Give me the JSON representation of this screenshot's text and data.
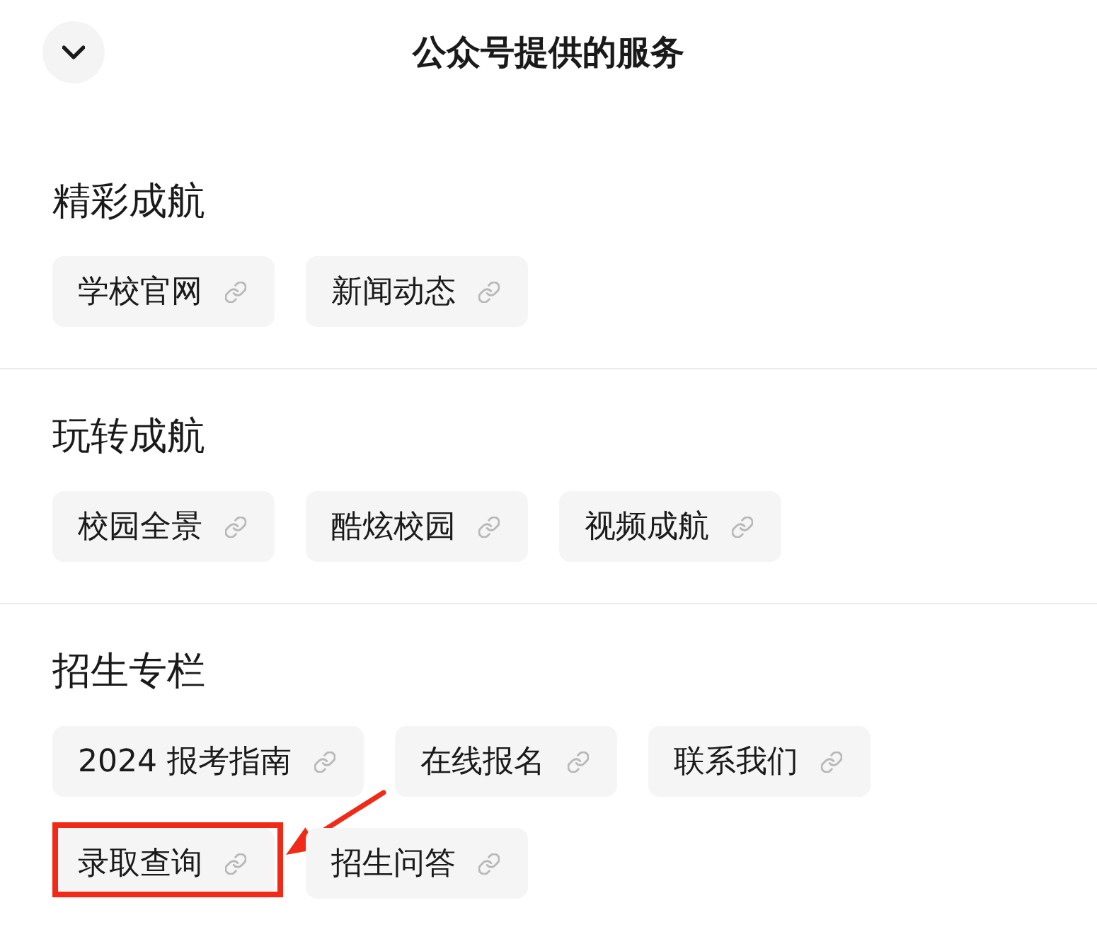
{
  "header": {
    "title": "公众号提供的服务"
  },
  "sections": [
    {
      "title": "精彩成航",
      "links": [
        {
          "label": "学校官网",
          "highlighted": false
        },
        {
          "label": "新闻动态",
          "highlighted": false
        }
      ]
    },
    {
      "title": "玩转成航",
      "links": [
        {
          "label": "校园全景",
          "highlighted": false
        },
        {
          "label": "酷炫校园",
          "highlighted": false
        },
        {
          "label": "视频成航",
          "highlighted": false
        }
      ]
    },
    {
      "title": "招生专栏",
      "links": [
        {
          "label": "2024 报考指南",
          "highlighted": false
        },
        {
          "label": "在线报名",
          "highlighted": false
        },
        {
          "label": "联系我们",
          "highlighted": false
        },
        {
          "label": "录取查询",
          "highlighted": true
        },
        {
          "label": "招生问答",
          "highlighted": false
        }
      ]
    }
  ]
}
